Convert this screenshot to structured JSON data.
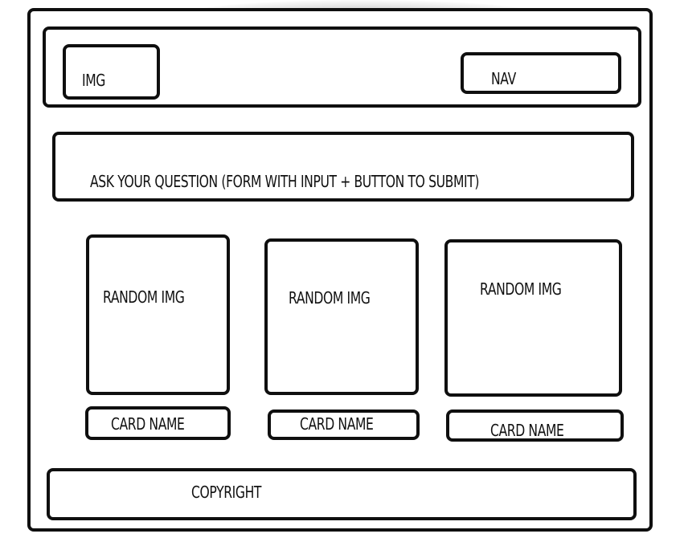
{
  "header": {
    "logo_label": "IMG",
    "nav_label": "NAV"
  },
  "question": {
    "label": "ASK YOUR QUESTION (FORM WITH INPUT + BUTTON TO SUBMIT)"
  },
  "cards": [
    {
      "image_label": "RANDOM IMG",
      "name_label": "CARD NAME"
    },
    {
      "image_label": "RANDOM IMG",
      "name_label": "CARD NAME"
    },
    {
      "image_label": "RANDOM IMG",
      "name_label": "CARD NAME"
    }
  ],
  "footer": {
    "label": "COPYRIGHT"
  }
}
